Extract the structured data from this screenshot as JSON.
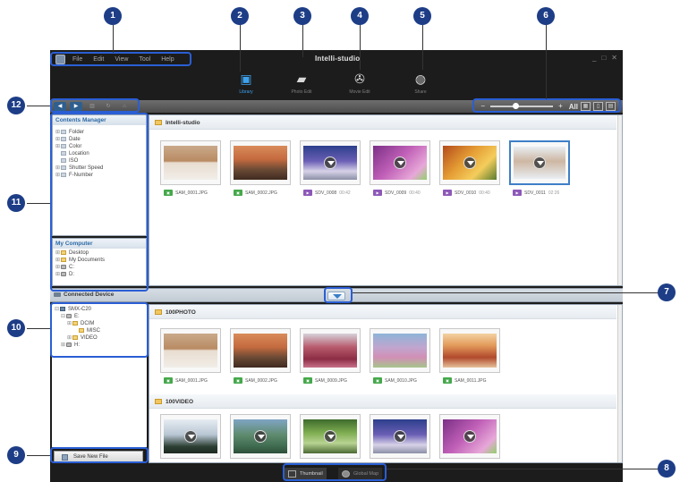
{
  "menu": {
    "items": [
      "File",
      "Edit",
      "View",
      "Tool",
      "Help"
    ]
  },
  "app_title": "Intelli-studio",
  "window_controls": [
    "_",
    "□",
    "✕"
  ],
  "modes": [
    {
      "label": "Library",
      "icon": "library-icon",
      "active": true
    },
    {
      "label": "Photo Edit",
      "icon": "photo-edit-icon",
      "active": false
    },
    {
      "label": "Movie Edit",
      "icon": "movie-edit-icon",
      "active": false
    },
    {
      "label": "Share",
      "icon": "share-globe-icon",
      "active": false
    }
  ],
  "toolbar": {
    "back": "◀",
    "forward": "▶",
    "zoom_out": "−",
    "zoom_in": "+",
    "all_label": "All",
    "zoom_level": 0.4
  },
  "contents_manager": {
    "title": "Contents Manager",
    "items": [
      "Folder",
      "Date",
      "Color",
      "Location",
      "ISO",
      "Shutter Speed",
      "F-Number"
    ]
  },
  "my_computer": {
    "title": "My Computer",
    "items": [
      "Desktop",
      "My Documents",
      "C:",
      "D:"
    ]
  },
  "library": {
    "folder": "Intelli-studio",
    "items": [
      {
        "name": "SAM_0001.JPG",
        "type": "photo",
        "duration": ""
      },
      {
        "name": "SAM_0002.JPG",
        "type": "photo",
        "duration": ""
      },
      {
        "name": "SDV_0008",
        "type": "video",
        "duration": "00:42"
      },
      {
        "name": "SDV_0009",
        "type": "video",
        "duration": "00:40"
      },
      {
        "name": "SDV_0010",
        "type": "video",
        "duration": "00:40"
      },
      {
        "name": "SDV_0011",
        "type": "video",
        "duration": "02:26"
      }
    ]
  },
  "connected_device": {
    "title": "Connected Device",
    "tree": [
      "SMX-C20",
      "E:",
      "DCIM",
      "MISC",
      "VIDEO",
      "H:"
    ]
  },
  "device_photo": {
    "folder": "100PHOTO",
    "items": [
      "SAM_0001.JPG",
      "SAM_0002.JPG",
      "SAM_0009.JPG",
      "SAM_0010.JPG",
      "SAM_0011.JPG"
    ]
  },
  "device_video": {
    "folder": "100VIDEO"
  },
  "save_new_file": "Save New File",
  "bottom_views": {
    "thumbnail": "Thumbnail",
    "global_map": "Global Map"
  },
  "callouts": [
    "1",
    "2",
    "3",
    "4",
    "5",
    "6",
    "7",
    "8",
    "9",
    "10",
    "11",
    "12"
  ]
}
